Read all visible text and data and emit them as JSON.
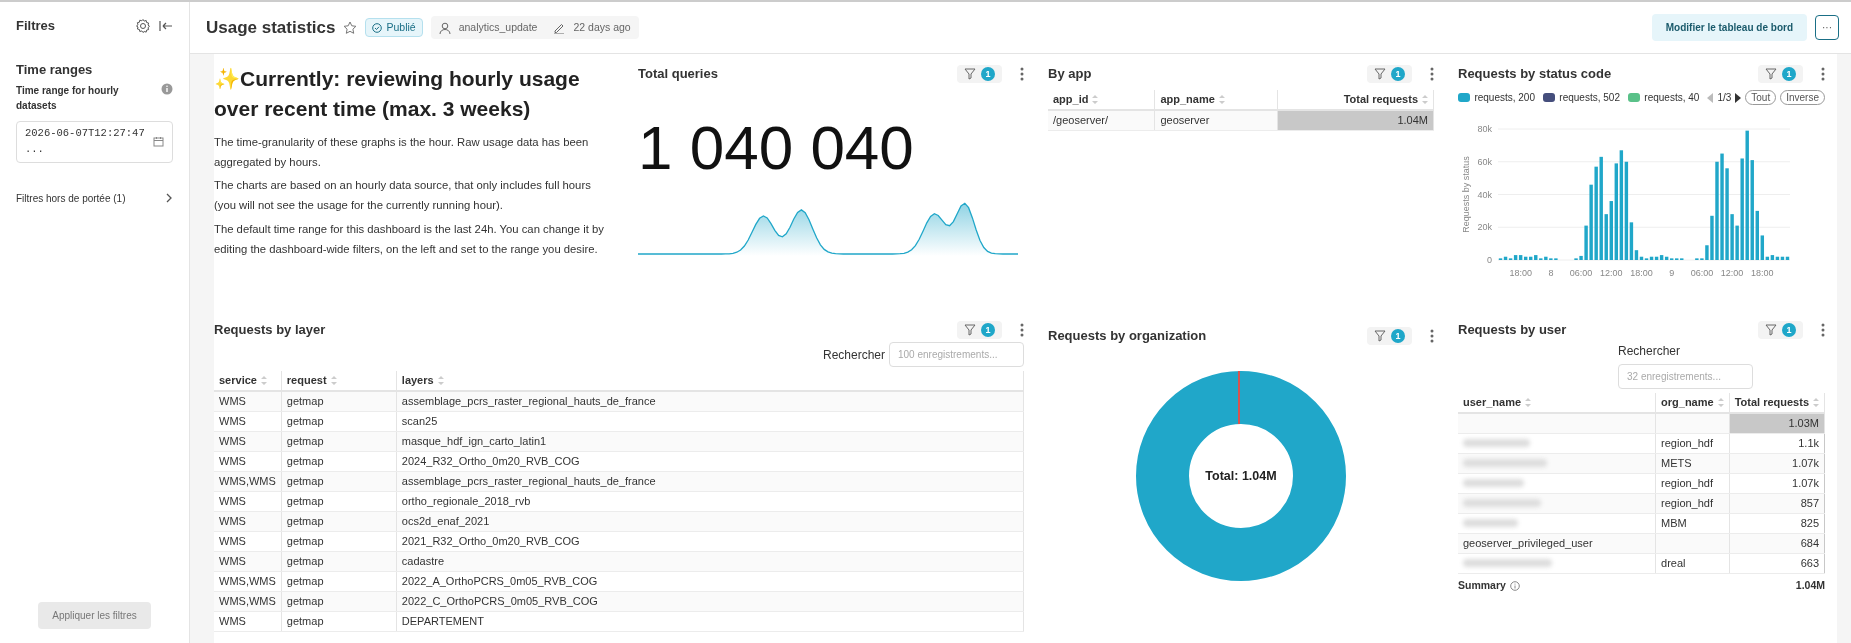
{
  "sidebar": {
    "title": "Filtres",
    "section_title": "Time ranges",
    "filter": {
      "label": "Time range for hourly datasets",
      "value": "2026-06-07T12:27:47 ..."
    },
    "out_of_scope": "Filtres hors de portée (1)",
    "apply_button": {
      "label": "Appliquer les filtres",
      "disabled": true
    }
  },
  "header": {
    "title": "Usage statistics",
    "favorite": false,
    "status": "Publié",
    "owner": "analytics_update",
    "modified": "22 days ago",
    "edit_button": "Modifier le tableau de bord",
    "more_button": "···"
  },
  "markdown": {
    "heading": "✨Currently: reviewing hourly usage over recent time (max. 3 weeks)",
    "paragraphs": [
      "The time-granularity of these graphs is the hour. Raw usage data has been aggregated by hours.",
      "The charts are based on an hourly data source, that only includes full hours (you will not see the usage for the currently running hour).",
      "The default time range for this dashboard is the last 24h. You can change it by editing the dashboard-wide filters, on the left and set to the range you desire."
    ]
  },
  "total_queries": {
    "title": "Total queries",
    "filter_count": "1",
    "value": "1 040 040"
  },
  "by_app": {
    "title": "By app",
    "filter_count": "1",
    "columns": [
      "app_id",
      "app_name",
      "Total requests"
    ],
    "rows": [
      {
        "cells": [
          "/geoserver/",
          "geoserver",
          "1.04M"
        ],
        "level": 1
      }
    ]
  },
  "status_code": {
    "title": "Requests by status code",
    "filter_count": "1",
    "legend": [
      {
        "label": "requests, 200",
        "color": "#20a7c9"
      },
      {
        "label": "requests, 502",
        "color": "#454e7c"
      },
      {
        "label": "requests, 40",
        "color": "#5ac189"
      }
    ],
    "page": "1/3",
    "buttons": [
      "Tout",
      "Inverse"
    ],
    "chart_data": {
      "type": "bar",
      "ylabel": "Requests by status",
      "grid": true,
      "categories": [
        null,
        null,
        null,
        null,
        "18:00",
        null,
        null,
        null,
        null,
        null,
        "8",
        null,
        null,
        null,
        null,
        null,
        "06:00",
        null,
        null,
        null,
        null,
        null,
        "12:00",
        null,
        null,
        null,
        null,
        null,
        "18:00",
        null,
        null,
        null,
        null,
        null,
        "9",
        null,
        null,
        null,
        null,
        null,
        "06:00",
        null,
        null,
        null,
        null,
        null,
        "12:00",
        null,
        null,
        null,
        null,
        null,
        "18:00",
        null,
        null,
        null,
        null,
        null
      ],
      "series": [
        {
          "color": "#20a7c9",
          "values": [
            1000,
            2000,
            1000,
            3000,
            3000,
            2000,
            2000,
            3000,
            1000,
            2000,
            1000,
            1000,
            0,
            0,
            0,
            1000,
            2500,
            21000,
            46000,
            57000,
            63000,
            28000,
            36000,
            59000,
            67000,
            60000,
            23000,
            6000,
            2000,
            1000,
            2000,
            2000,
            3000,
            2000,
            1000,
            1000,
            1000,
            0,
            0,
            1000,
            1000,
            9000,
            27000,
            60000,
            65000,
            56000,
            28000,
            21000,
            62000,
            79000,
            61000,
            30000,
            15000,
            2000,
            3000,
            2000,
            2000,
            2000
          ]
        }
      ],
      "ylim": [
        0,
        80000
      ],
      "yticks": [
        {
          "value": 0,
          "label": "0"
        },
        {
          "value": 20000,
          "label": "20k"
        },
        {
          "value": 40000,
          "label": "40k"
        },
        {
          "value": 60000,
          "label": "60k"
        },
        {
          "value": 80000,
          "label": "80k"
        }
      ]
    }
  },
  "by_layer": {
    "title": "Requests by layer",
    "filter_count": "1",
    "search_label": "Rechercher",
    "search_placeholder": "100 enregistrements...",
    "columns": [
      "service",
      "request",
      "layers"
    ],
    "rows": [
      [
        "WMS",
        "getmap",
        "assemblage_pcrs_raster_regional_hauts_de_france"
      ],
      [
        "WMS",
        "getmap",
        "scan25"
      ],
      [
        "WMS",
        "getmap",
        "masque_hdf_ign_carto_latin1"
      ],
      [
        "WMS",
        "getmap",
        "2024_R32_Ortho_0m20_RVB_COG"
      ],
      [
        "WMS,WMS",
        "getmap",
        "assemblage_pcrs_raster_regional_hauts_de_france"
      ],
      [
        "WMS",
        "getmap",
        "ortho_regionale_2018_rvb"
      ],
      [
        "WMS",
        "getmap",
        "ocs2d_enaf_2021"
      ],
      [
        "WMS",
        "getmap",
        "2021_R32_Ortho_0m20_RVB_COG"
      ],
      [
        "WMS",
        "getmap",
        "cadastre"
      ],
      [
        "WMS,WMS",
        "getmap",
        "2022_A_OrthoPCRS_0m05_RVB_COG"
      ],
      [
        "WMS,WMS",
        "getmap",
        "2022_C_OrthoPCRS_0m05_RVB_COG"
      ],
      [
        "WMS",
        "getmap",
        "DEPARTEMENT"
      ]
    ]
  },
  "by_organization": {
    "title": "Requests by organization",
    "filter_count": "1",
    "center_label": "Total: 1.04M"
  },
  "by_user": {
    "title": "Requests by user",
    "filter_count": "1",
    "search_label": "Rechercher",
    "search_placeholder": "32 enregistrements...",
    "columns": [
      "user_name",
      "org_name",
      "Total requests"
    ],
    "rows": [
      {
        "redacted": false,
        "total": "1.03M",
        "level": 1
      },
      {
        "redacted": true,
        "org": "region_hdf",
        "total": "1.1k",
        "level": 0.001
      },
      {
        "redacted": true,
        "org": "METS",
        "total": "1.07k",
        "level": 0.001
      },
      {
        "redacted": true,
        "org": "region_hdf",
        "total": "1.07k",
        "level": 0.001
      },
      {
        "redacted": true,
        "org": "region_hdf",
        "total": "857",
        "level": 0.001
      },
      {
        "redacted": true,
        "org": "MBM",
        "total": "825",
        "level": 0.001
      },
      {
        "redacted": false,
        "user": "geoserver_privileged_user",
        "total": "684",
        "level": 0.001
      },
      {
        "redacted": true,
        "org": "dreal",
        "total": "663",
        "level": 0.001
      }
    ],
    "summary_label": "Summary",
    "summary_value": "1.04M"
  }
}
